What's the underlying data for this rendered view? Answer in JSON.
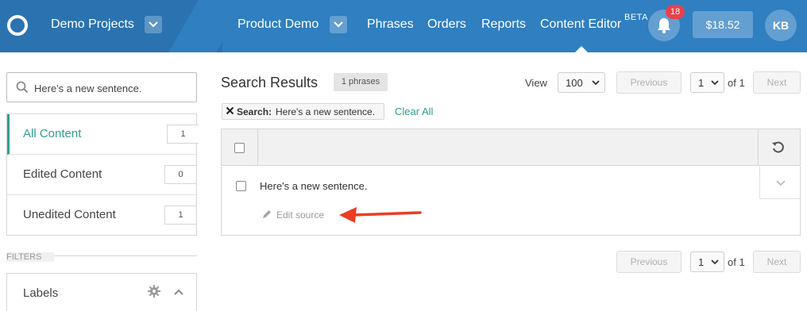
{
  "header": {
    "project_label": "Demo Projects",
    "product_label": "Product Demo",
    "nav": [
      "Phrases",
      "Orders",
      "Reports",
      "Content Editor"
    ],
    "beta_label": "BETA",
    "notification_count": "18",
    "balance": "$18.52",
    "user_initials": "KB",
    "colors": {
      "bar": "#2f7fc1",
      "badge": "#e8414b"
    }
  },
  "sidebar": {
    "search_value": "Here's a new sentence.",
    "filters": [
      {
        "label": "All Content",
        "count": "1"
      },
      {
        "label": "Edited Content",
        "count": "0"
      },
      {
        "label": "Unedited Content",
        "count": "1"
      }
    ],
    "filters_heading": "FILTERS",
    "labels_section": "Labels",
    "accent": "#2f9e8f"
  },
  "main": {
    "title": "Search Results",
    "count_pill": "1 phrases",
    "view_label": "View",
    "per_page": "100",
    "pagination": {
      "previous": "Previous",
      "next": "Next",
      "page": "1",
      "of_label": "of 1"
    },
    "search_chip": {
      "key": "Search:",
      "value": "Here's a new sentence."
    },
    "clear_all": "Clear All",
    "rows": [
      {
        "text": "Here's a new sentence.",
        "action": "Edit source"
      }
    ]
  }
}
